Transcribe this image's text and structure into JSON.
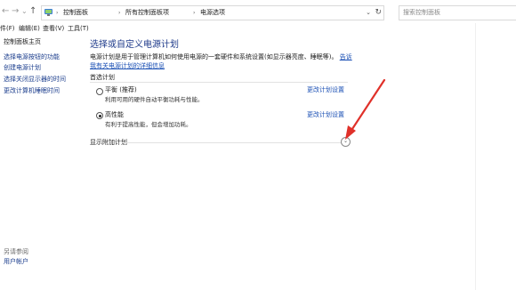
{
  "nav": {
    "back": "←",
    "forward": "→",
    "history": "⌄",
    "up": "↑"
  },
  "address": {
    "crumbs": [
      "控制面板",
      "所有控制面板项",
      "电源选项"
    ],
    "separator": "›",
    "dropdown": "⌄",
    "refresh": "↻"
  },
  "search": {
    "placeholder": "搜索控制面板"
  },
  "menu": {
    "items": [
      "件(F)",
      "编辑(E)",
      "查看(V)",
      "工具(T)"
    ]
  },
  "sidebar": {
    "home": "控制面板主页",
    "items": [
      "选择电源按钮的功能",
      "创建电源计划",
      "选择关闭显示器的时间",
      "更改计算机睡眠时间"
    ],
    "see_also": "另请参阅",
    "see_also_link": "用户帐户"
  },
  "main": {
    "title": "选择或自定义电源计划",
    "description": "电源计划是用于管理计算机如何使用电源的一套硬件和系统设置(如显示器亮度、睡眠等)。",
    "description_link": "告诉我有关电源计划的详细信息",
    "section_title": "首选计划",
    "plans": [
      {
        "name": "平衡 (推荐)",
        "desc": "利用可用的硬件自动平衡功耗与性能。",
        "change": "更改计划设置",
        "selected": false
      },
      {
        "name": "高性能",
        "desc": "有利于提高性能，但会增加功耗。",
        "change": "更改计划设置",
        "selected": true
      }
    ],
    "show_more": "显示附加计划",
    "expand_glyph": "⌄"
  },
  "colors": {
    "annotation_arrow": "#e0312a",
    "link": "#1a4fb4"
  }
}
